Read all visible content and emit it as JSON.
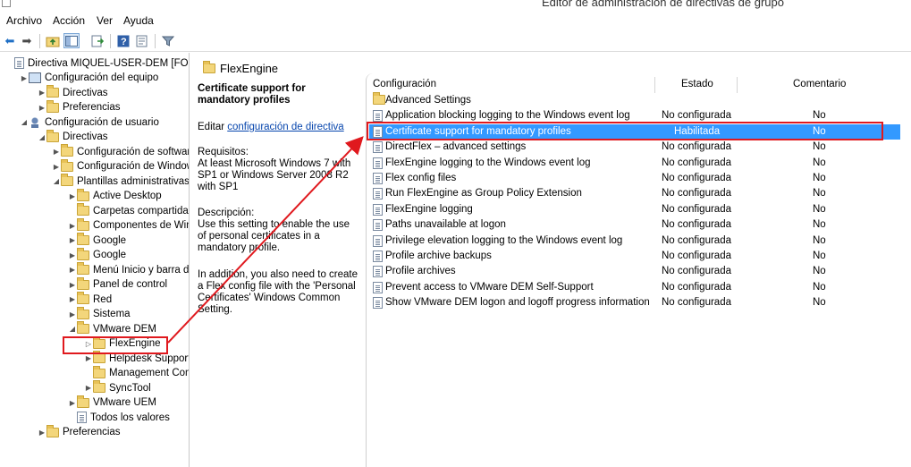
{
  "window": {
    "title": "Editor de administración de directivas de grupo"
  },
  "menu": [
    "Archivo",
    "Acción",
    "Ver",
    "Ayuda"
  ],
  "toolbar": [
    "back-icon",
    "forward-icon",
    "up-folder-icon",
    "show-hide-tree-icon",
    "export-list-icon",
    "help-icon",
    "properties-icon",
    "filter-icon"
  ],
  "tree": [
    {
      "label": "Directiva MIQUEL-USER-DEM [FORMAC",
      "icon": "document-icon",
      "arrow": "",
      "level": 0
    },
    {
      "label": "Configuración del equipo",
      "icon": "computer-icon",
      "arrow": "▶",
      "level": 1
    },
    {
      "label": "Directivas",
      "icon": "folder-icon",
      "arrow": "▶",
      "level": 2
    },
    {
      "label": "Preferencias",
      "icon": "folder-icon",
      "arrow": "▶",
      "level": 2
    },
    {
      "label": "Configuración de usuario",
      "icon": "user-icon",
      "arrow": "◢",
      "level": 1
    },
    {
      "label": "Directivas",
      "icon": "folder-icon",
      "arrow": "◢",
      "level": 2
    },
    {
      "label": "Configuración de software",
      "icon": "folder-icon",
      "arrow": "▶",
      "level": 3
    },
    {
      "label": "Configuración de Windows",
      "icon": "folder-icon",
      "arrow": "▶",
      "level": 3
    },
    {
      "label": "Plantillas administrativas: de",
      "icon": "folder-icon",
      "arrow": "◢",
      "level": 3
    },
    {
      "label": "Active Desktop",
      "icon": "folder-icon",
      "arrow": "▶",
      "level": 4
    },
    {
      "label": "Carpetas compartidas",
      "icon": "folder-icon",
      "arrow": "",
      "level": 4
    },
    {
      "label": "Componentes de Windo",
      "icon": "folder-icon",
      "arrow": "▶",
      "level": 4
    },
    {
      "label": "Google",
      "icon": "folder-icon",
      "arrow": "▶",
      "level": 4
    },
    {
      "label": "Google",
      "icon": "folder-icon",
      "arrow": "▶",
      "level": 4
    },
    {
      "label": "Menú Inicio y barra de ta",
      "icon": "folder-icon",
      "arrow": "▶",
      "level": 4
    },
    {
      "label": "Panel de control",
      "icon": "folder-icon",
      "arrow": "▶",
      "level": 4
    },
    {
      "label": "Red",
      "icon": "folder-icon",
      "arrow": "▶",
      "level": 4
    },
    {
      "label": "Sistema",
      "icon": "folder-icon",
      "arrow": "▶",
      "level": 4
    },
    {
      "label": "VMware DEM",
      "icon": "folder-icon",
      "arrow": "◢",
      "level": 4
    },
    {
      "label": "FlexEngine",
      "icon": "folder-icon",
      "arrow": "▷",
      "level": 5,
      "highlighted": true
    },
    {
      "label": "Helpdesk Support To",
      "icon": "folder-icon",
      "arrow": "▶",
      "level": 5
    },
    {
      "label": "Management Consol",
      "icon": "folder-icon",
      "arrow": "",
      "level": 5
    },
    {
      "label": "SyncTool",
      "icon": "folder-icon",
      "arrow": "▶",
      "level": 5
    },
    {
      "label": "VMware UEM",
      "icon": "folder-icon",
      "arrow": "▶",
      "level": 4
    },
    {
      "label": "Todos los valores",
      "icon": "settings-icon",
      "arrow": "",
      "level": 4
    },
    {
      "label": "Preferencias",
      "icon": "folder-icon",
      "arrow": "▶",
      "level": 2
    }
  ],
  "content_header": {
    "title": "FlexEngine"
  },
  "description": {
    "heading": "Certificate support for mandatory profiles",
    "edit_prefix": "Editar ",
    "edit_link": "configuración de directiva",
    "requirements_label": "Requisitos:",
    "requirements_text": "At least Microsoft Windows 7 with SP1 or Windows Server 2008 R2 with SP1",
    "description_label": "Descripción:",
    "description_text": "Use this setting to enable the use of personal certificates in a mandatory profile.",
    "description_text2": "In addition, you also need to create a Flex config file with the 'Personal Certificates' Windows Common Setting."
  },
  "columns": {
    "name": "Configuración",
    "state": "Estado",
    "comment": "Comentario"
  },
  "settings": [
    {
      "name": "Advanced Settings",
      "state": "",
      "comment": "",
      "type": "folder"
    },
    {
      "name": "Application blocking logging to the Windows event log",
      "state": "No configurada",
      "comment": "No",
      "type": "setting"
    },
    {
      "name": "Certificate support for mandatory profiles",
      "state": "Habilitada",
      "comment": "No",
      "type": "setting",
      "selected": true
    },
    {
      "name": "DirectFlex – advanced settings",
      "state": "No configurada",
      "comment": "No",
      "type": "setting"
    },
    {
      "name": "FlexEngine logging to the Windows event log",
      "state": "No configurada",
      "comment": "No",
      "type": "setting"
    },
    {
      "name": "Flex config files",
      "state": "No configurada",
      "comment": "No",
      "type": "setting"
    },
    {
      "name": "Run FlexEngine as Group Policy Extension",
      "state": "No configurada",
      "comment": "No",
      "type": "setting"
    },
    {
      "name": "FlexEngine logging",
      "state": "No configurada",
      "comment": "No",
      "type": "setting"
    },
    {
      "name": "Paths unavailable at logon",
      "state": "No configurada",
      "comment": "No",
      "type": "setting"
    },
    {
      "name": "Privilege elevation logging to the Windows event log",
      "state": "No configurada",
      "comment": "No",
      "type": "setting"
    },
    {
      "name": "Profile archive backups",
      "state": "No configurada",
      "comment": "No",
      "type": "setting"
    },
    {
      "name": "Profile archives",
      "state": "No configurada",
      "comment": "No",
      "type": "setting"
    },
    {
      "name": "Prevent access to VMware DEM Self-Support",
      "state": "No configurada",
      "comment": "No",
      "type": "setting"
    },
    {
      "name": "Show VMware DEM logon and logoff progress information",
      "state": "No configurada",
      "comment": "No",
      "type": "setting"
    }
  ],
  "colors": {
    "selection": "#3399ff",
    "annotation": "#e0191e",
    "link": "#0645ad"
  }
}
